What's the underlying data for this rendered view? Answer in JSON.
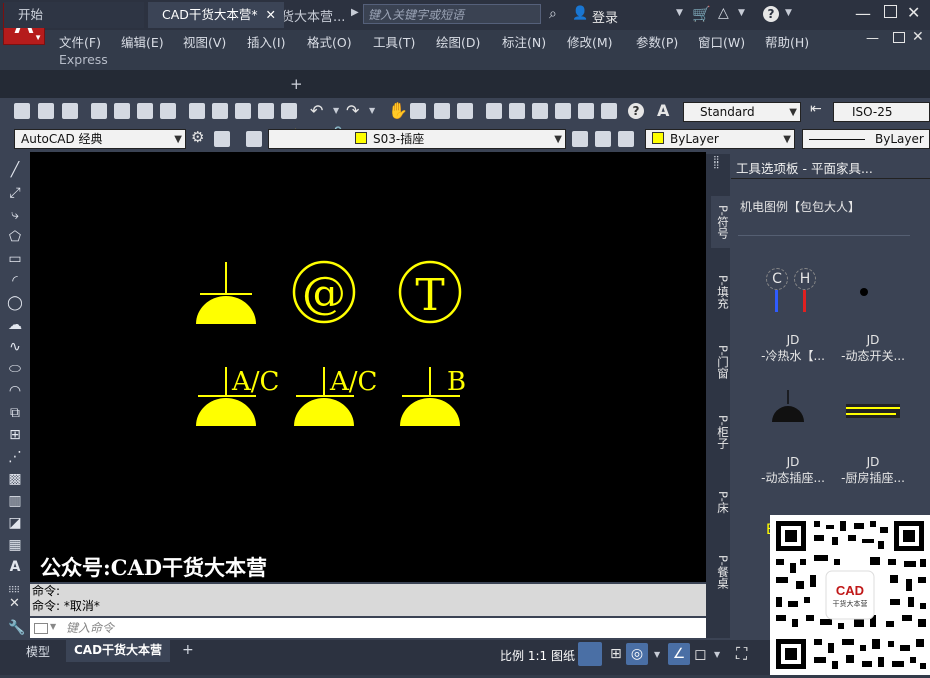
{
  "app": {
    "logo_letter": "A",
    "logo_sub": "CAD",
    "title": "CAD干货大本营...",
    "search_placeholder": "键入关键字或短语",
    "login_label": "登录"
  },
  "menu": {
    "items": [
      "文件(F)",
      "编辑(E)",
      "视图(V)",
      "插入(I)",
      "格式(O)",
      "工具(T)",
      "绘图(D)",
      "标注(N)",
      "修改(M)",
      "参数(P)",
      "窗口(W)",
      "帮助(H)"
    ],
    "express": "Express"
  },
  "tabs": {
    "start": "开始",
    "doc": "CAD干货大本营*",
    "close": "✕",
    "add": "+"
  },
  "toolbar": {
    "text_style": "Standard",
    "dim_style": "ISO-25",
    "workspace": "AutoCAD 经典",
    "layer": "S03-插座",
    "color": "ByLayer",
    "linetype": "ByLayer"
  },
  "canvas": {
    "watermark": "公众号:CAD干货大本营",
    "sym_at": "@",
    "sym_t": "T",
    "label_ac1": "A/C",
    "label_ac2": "A/C",
    "label_b": "B"
  },
  "command": {
    "line1": "命令:",
    "line2": "命令: *取消*",
    "input_placeholder": "键入命令"
  },
  "status": {
    "model_tab": "模型",
    "layout_tab": "CAD干货大本营",
    "add": "+",
    "scale": "比例 1:1",
    "paper": "图纸"
  },
  "palette": {
    "title": "工具选项板 - 平面家具...",
    "header": "机电图例【包包大人】",
    "tabs": [
      "P-符号",
      "P-填充",
      "P-门窗",
      "P-柜子",
      "P-床",
      "P-餐桌"
    ],
    "items": [
      {
        "top": "JD",
        "bottom": "-冷热水【..."
      },
      {
        "top": "JD",
        "bottom": "-动态开关..."
      },
      {
        "top": "JD",
        "bottom": "-动态插座..."
      },
      {
        "top": "JD",
        "bottom": "-厨房插座..."
      }
    ],
    "hot_c": "C",
    "hot_h": "H",
    "qr_label": "CAD",
    "qr_sub": "干货大本营"
  },
  "colors": {
    "accent_yellow": "#ffff00",
    "canvas_bg": "#000000",
    "ui_dark": "#333b4a",
    "logo_red": "#b51c1c"
  }
}
